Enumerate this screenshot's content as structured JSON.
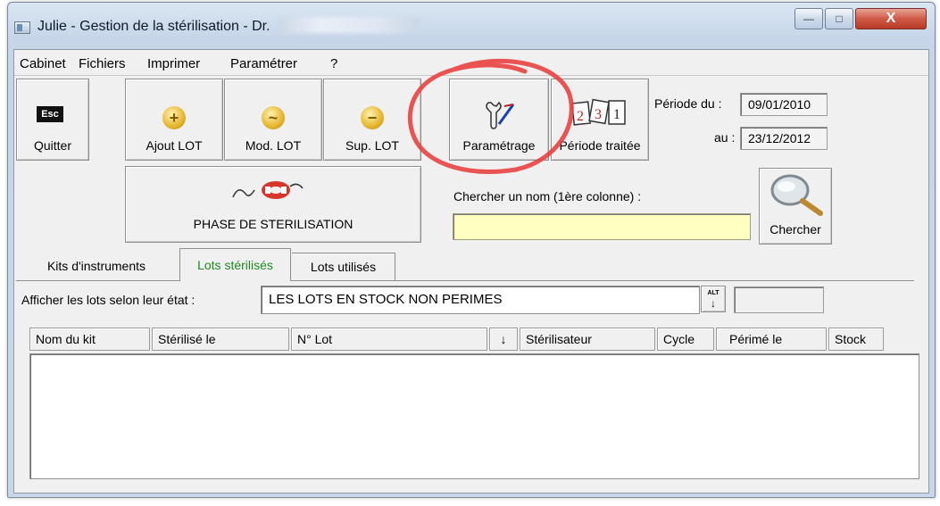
{
  "window": {
    "title": "Julie - Gestion de la stérilisation  - Dr. ",
    "controls": {
      "minimize": "—",
      "maximize": "□",
      "close": "X"
    }
  },
  "menu": [
    "Cabinet",
    "Fichiers",
    "Imprimer",
    "Paramétrer",
    "?"
  ],
  "toolbar": {
    "quit": {
      "key": "Esc",
      "label": "Quitter"
    },
    "add": {
      "symbol": "+",
      "label": "Ajout LOT"
    },
    "mod": {
      "symbol": "~",
      "label": "Mod. LOT"
    },
    "del": {
      "symbol": "−",
      "label": "Sup. LOT"
    },
    "settings": {
      "label": "Paramétrage"
    },
    "period": {
      "label": "Période traitée"
    }
  },
  "period": {
    "from_label": "Période du :",
    "from_value": "09/01/2010",
    "to_label": "au :",
    "to_value": "23/12/2012"
  },
  "phase_button": {
    "label": "PHASE DE STERILISATION"
  },
  "search": {
    "label": "Chercher un nom (1ère colonne) :",
    "value": "",
    "button_label": "Chercher"
  },
  "tabs": [
    {
      "label": "Kits d'instruments",
      "active": false
    },
    {
      "label": "Lots stérilisés",
      "active": true
    },
    {
      "label": "Lots utilisés",
      "active": false
    }
  ],
  "filter": {
    "label": "Afficher les lots selon leur état :",
    "value": "LES LOTS EN STOCK NON PERIMES",
    "alt_key": "ALT"
  },
  "table": {
    "columns": [
      "Nom du kit",
      "Stérilisé le",
      "N° Lot",
      "↓",
      "Stérilisateur",
      "Cycle",
      "Périmé le",
      "Stock"
    ],
    "rows": []
  },
  "colors": {
    "search_bg": "#ffffc0",
    "active_tab_text": "#1e8a1e",
    "annotation_circle": "#e8413f"
  }
}
